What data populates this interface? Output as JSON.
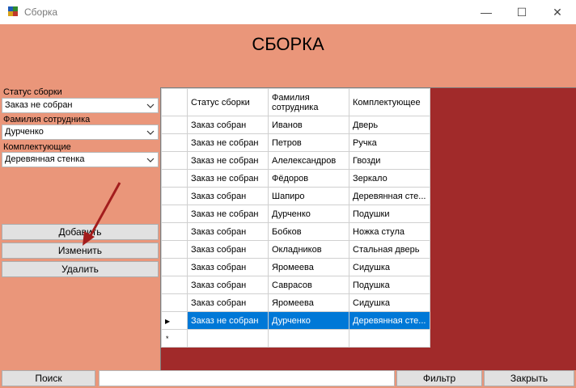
{
  "window": {
    "title": "Сборка",
    "minimize": "—",
    "maximize": "☐",
    "close": "✕"
  },
  "header": {
    "title": "СБОРКА"
  },
  "filters": {
    "status_label": "Статус сборки",
    "status_value": "Заказ не собран",
    "employee_label": "Фамилия сотрудника",
    "employee_value": "Дурченко",
    "component_label": "Комплектующие",
    "component_value": "Деревянная стенка"
  },
  "actions": {
    "add_label": "Добавить",
    "edit_label": "Изменить",
    "delete_label": "Удалить"
  },
  "grid": {
    "columns": [
      "Статус сборки",
      "Фамилия сотрудника",
      "Комплектующее"
    ],
    "rows": [
      [
        "Заказ собран",
        "Иванов",
        "Дверь"
      ],
      [
        "Заказ не собран",
        "Петров",
        "Ручка"
      ],
      [
        "Заказ не собран",
        "Алелександров",
        "Гвозди"
      ],
      [
        "Заказ не собран",
        "Фёдоров",
        "Зеркало"
      ],
      [
        "Заказ собран",
        "Шапиро",
        "Деревянная сте..."
      ],
      [
        "Заказ не собран",
        "Дурченко",
        "Подушки"
      ],
      [
        "Заказ собран",
        "Бобков",
        "Ножка стула"
      ],
      [
        "Заказ собран",
        "Окладников",
        "Стальная дверь"
      ],
      [
        "Заказ собран",
        "Яромеева",
        "Сидушка"
      ],
      [
        "Заказ собран",
        "Саврасов",
        "Подушка"
      ],
      [
        "Заказ собран",
        "Яромеева",
        "Сидушка"
      ],
      [
        "Заказ не собран",
        "Дурченко",
        "Деревянная сте..."
      ]
    ],
    "selected_row": 11,
    "current_row_marker": "▶",
    "new_row_marker": "*"
  },
  "bottom": {
    "search_label": "Поиск",
    "search_value": "",
    "filter_label": "Фильтр",
    "close_label": "Закрыть"
  },
  "colors": {
    "form_bg": "#ea967a",
    "grid_bg": "#a12a2a",
    "selection": "#0078d7",
    "annotation_arrow": "#a31d1d"
  }
}
